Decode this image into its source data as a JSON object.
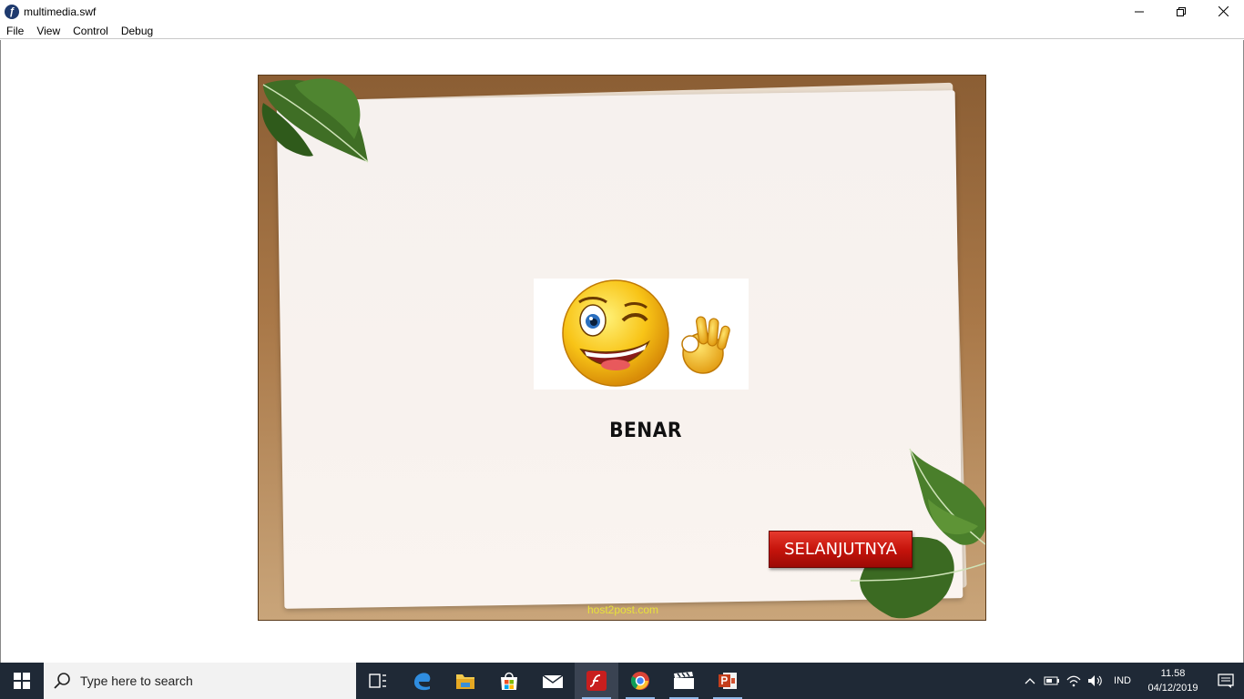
{
  "window": {
    "title": "multimedia.swf",
    "controls": {
      "minimize": "—",
      "restore": "❐",
      "close": "✕"
    }
  },
  "menu": [
    "File",
    "View",
    "Control",
    "Debug"
  ],
  "stage": {
    "result_text": "BENAR",
    "next_button": "SELANJUTNYA",
    "watermark": "host2post.com",
    "colors": {
      "frame": "#a97848",
      "button": "#c6140c",
      "watermark": "#e8e23a"
    }
  },
  "taskbar": {
    "search_placeholder": "Type here to search",
    "apps": [
      "task-view",
      "edge",
      "file-explorer",
      "store",
      "mail",
      "flash-player",
      "chrome",
      "movie-maker",
      "powerpoint"
    ],
    "tray": {
      "language": "IND",
      "time": "11.58",
      "date": "04/12/2019"
    }
  }
}
